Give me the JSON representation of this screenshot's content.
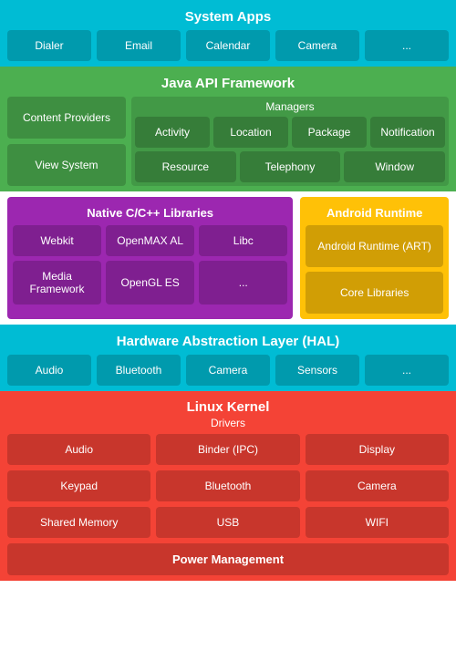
{
  "system_apps": {
    "title": "System Apps",
    "items": [
      "Dialer",
      "Email",
      "Calendar",
      "Camera",
      "..."
    ]
  },
  "java_api": {
    "title": "Java API Framework",
    "left_items": [
      "Content Providers",
      "View System"
    ],
    "managers_label": "Managers",
    "managers_row1": [
      "Activity",
      "Location",
      "Package",
      "Notification"
    ],
    "managers_row2": [
      "Resource",
      "Telephony",
      "Window"
    ]
  },
  "native": {
    "title": "Native C/C++ Libraries",
    "items": [
      "Webkit",
      "OpenMAX AL",
      "Libc",
      "Media Framework",
      "OpenGL ES",
      "..."
    ]
  },
  "android_runtime": {
    "title": "Android Runtime",
    "items": [
      "Android Runtime (ART)",
      "Core Libraries"
    ]
  },
  "hal": {
    "title": "Hardware Abstraction Layer (HAL)",
    "items": [
      "Audio",
      "Bluetooth",
      "Camera",
      "Sensors",
      "..."
    ]
  },
  "kernel": {
    "title": "Linux Kernel",
    "drivers_label": "Drivers",
    "items": [
      "Audio",
      "Binder (IPC)",
      "Display",
      "Keypad",
      "Bluetooth",
      "Camera",
      "Shared Memory",
      "USB",
      "WIFI"
    ],
    "power_label": "Power Management"
  }
}
